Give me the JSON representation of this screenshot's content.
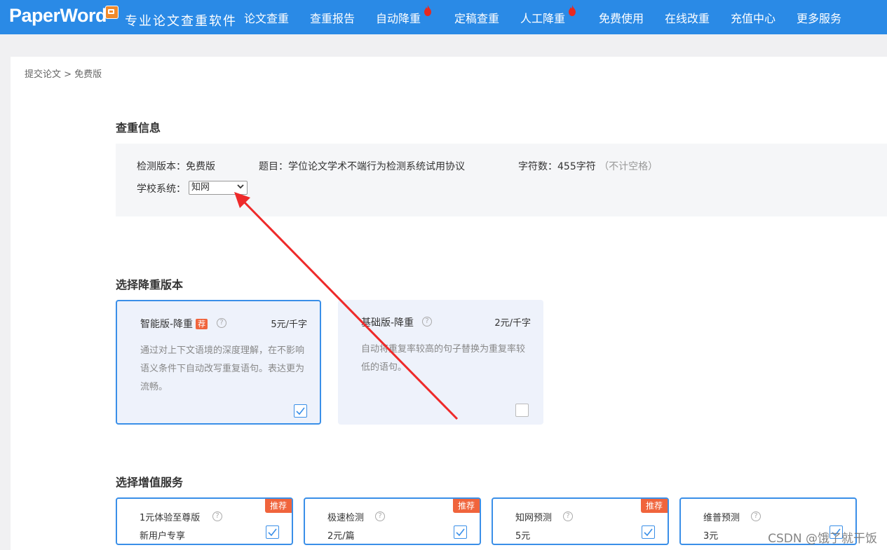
{
  "header": {
    "logo": "PaperWord",
    "slogan": "专业论文查重软件",
    "nav": [
      {
        "label": "论文查重",
        "hot": false
      },
      {
        "label": "查重报告",
        "hot": false
      },
      {
        "label": "自动降重",
        "hot": true
      },
      {
        "label": "定稿查重",
        "hot": false
      },
      {
        "label": "人工降重",
        "hot": true
      },
      {
        "label": "免费使用",
        "hot": false
      },
      {
        "label": "在线改重",
        "hot": false
      },
      {
        "label": "充值中心",
        "hot": false
      },
      {
        "label": "更多服务",
        "hot": false
      }
    ]
  },
  "breadcrumb": "提交论文 > 免费版",
  "check_info": {
    "title": "查重信息",
    "version_label": "检测版本：免费版",
    "topic_label": "题目：学位论文学术不端行为检测系统试用协议",
    "chars_label": "字符数：455字符",
    "chars_note": "（不计空格）",
    "school_label": "学校系统：",
    "school_value": "知网"
  },
  "rewrite": {
    "title": "选择降重版本",
    "cards": [
      {
        "name": "智能版-降重",
        "tag": "荐",
        "price": "5元/千字",
        "desc": "通过对上下文语境的深度理解，在不影响语义条件下自动改写重复语句。表达更为流畅。",
        "checked": true
      },
      {
        "name": "基础版-降重",
        "tag": "",
        "price": "2元/千字",
        "desc": "自动将重复率较高的句子替换为重复率较低的语句。",
        "checked": false
      }
    ]
  },
  "services": {
    "title": "选择增值服务",
    "items": [
      {
        "name": "1元体验至尊版",
        "sub": "新用户专享",
        "tag": "推荐",
        "checked": true
      },
      {
        "name": "极速检测",
        "sub": "2元/篇",
        "tag": "推荐",
        "checked": true
      },
      {
        "name": "知网预测",
        "sub": "5元",
        "tag": "推荐",
        "checked": true
      },
      {
        "name": "维普预测",
        "sub": "3元",
        "tag": "",
        "checked": true
      }
    ]
  },
  "help_glyph": "?",
  "watermark": "CSDN @饿了就干饭",
  "colors": {
    "brand": "#2a8ae6",
    "accent": "#f0643c",
    "selected_border": "#3a8fe8",
    "arrow": "#ee2a2a"
  }
}
